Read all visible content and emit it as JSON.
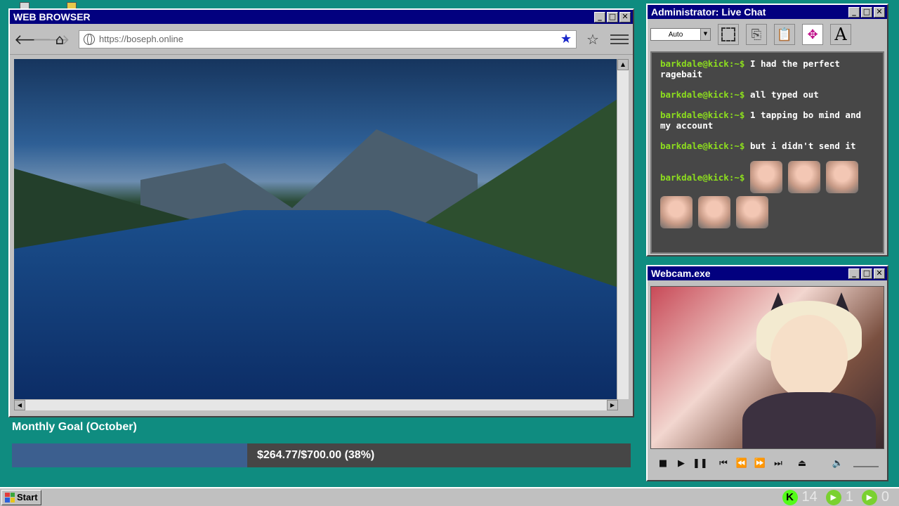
{
  "browser": {
    "title": "WEB BROWSER",
    "url": "https://boseph.online",
    "buttons": {
      "minimize": "_",
      "maximize": "□",
      "close": "✕",
      "back": "←",
      "forward": "→",
      "home": "⌂"
    }
  },
  "goal": {
    "title": "Monthly Goal (October)",
    "text": "$264.77/$700.00 (38%)",
    "progress_percent": 38
  },
  "chat": {
    "title": "Administrator: Live Chat",
    "font_select": "Auto",
    "messages": [
      {
        "user": "barkdale@kick:~$",
        "text": "I had the perfect ragebait"
      },
      {
        "user": "barkdale@kick:~$",
        "text": "all typed out"
      },
      {
        "user": "barkdale@kick:~$",
        "text": "1 tapping bo mind and my account"
      },
      {
        "user": "barkdale@kick:~$",
        "text": "but i didn't send it"
      },
      {
        "user": "barkdale@kick:~$",
        "text": ""
      }
    ]
  },
  "webcam": {
    "title": "Webcam.exe"
  },
  "taskbar": {
    "start_label": "Start",
    "stats": [
      {
        "icon": "kick-icon",
        "value": "14"
      },
      {
        "icon": "play-icon",
        "value": "1"
      },
      {
        "icon": "play-icon",
        "value": "0"
      }
    ]
  },
  "colors": {
    "desktop": "#0f8c80",
    "titlebar": "#02007f",
    "chat_username": "#8dde1e",
    "goal_fill": "#3c5f8f"
  }
}
